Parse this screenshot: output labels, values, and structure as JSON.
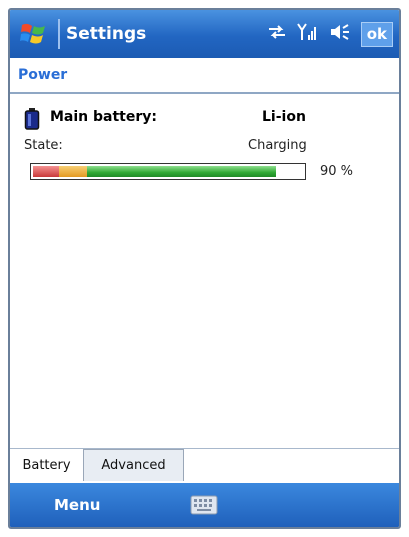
{
  "titlebar": {
    "title": "Settings",
    "ok_label": "ok",
    "icons": [
      "windows-start-icon",
      "connectivity-arrows-icon",
      "signal-strength-icon",
      "speaker-icon"
    ]
  },
  "page": {
    "title": "Power"
  },
  "battery": {
    "label": "Main battery:",
    "type": "Li-ion",
    "state_label": "State:",
    "state_value": "Charging",
    "level_percent": 90,
    "level_text": "90 %"
  },
  "tabs": [
    {
      "label": "Battery",
      "selected": true
    },
    {
      "label": "Advanced",
      "selected": false
    }
  ],
  "softkeys": {
    "left": "Menu",
    "center_icon": "keyboard-icon"
  },
  "colors": {
    "titlebar_blue": "#2266c2",
    "accent_title": "#2a6ed6",
    "bar_red": "#c93a3a",
    "bar_orange": "#e39a22",
    "bar_green": "#2fa833"
  }
}
